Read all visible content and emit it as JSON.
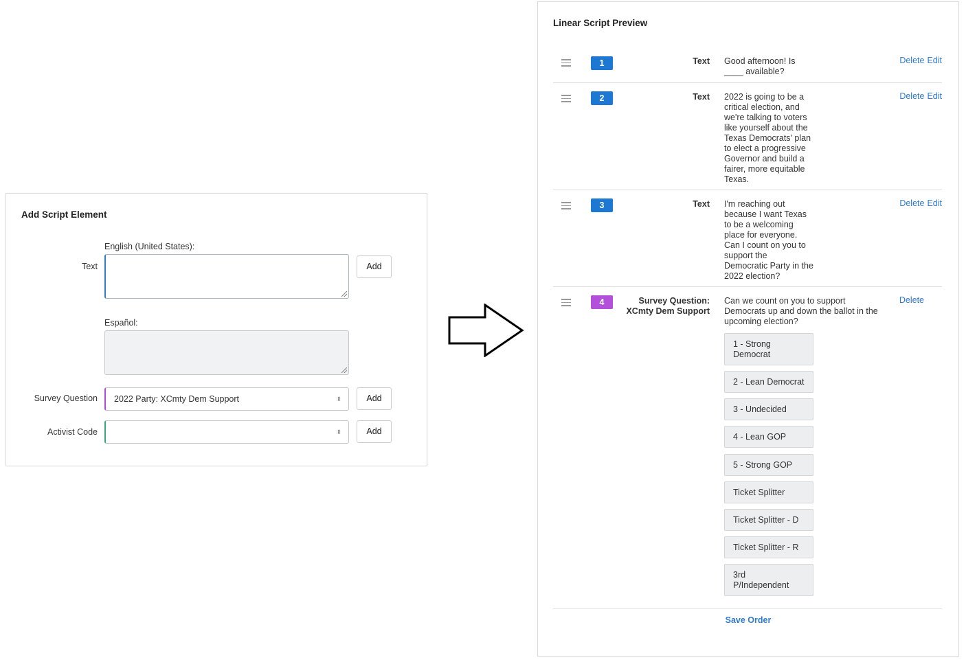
{
  "add_panel": {
    "title": "Add Script Element",
    "english_label": "English (United States):",
    "text_label": "Text",
    "spanish_label": "Español:",
    "survey_label": "Survey Question",
    "survey_value": "2022 Party: XCmty Dem Support",
    "activist_label": "Activist Code",
    "activist_value": "",
    "add_label": "Add"
  },
  "preview": {
    "title": "Linear Script Preview",
    "rows": [
      {
        "num": "1",
        "type": "Text",
        "text": [
          "Good afternoon! Is",
          "____ available?"
        ],
        "delete": "Delete",
        "edit": "Edit"
      },
      {
        "num": "2",
        "type": "Text",
        "text": [
          "2022 is going to be a",
          "critical election, and",
          "we're talking to voters",
          "like yourself about the",
          "Texas Democrats' plan",
          "to elect a progressive",
          "Governor and build a",
          "fairer, more equitable",
          "Texas."
        ],
        "delete": "Delete",
        "edit": "Edit"
      },
      {
        "num": "3",
        "type": "Text",
        "text": [
          "I'm reaching out",
          "because I want Texas",
          "to be a welcoming",
          "place for everyone.",
          "Can I count on you to",
          "support the",
          "Democratic Party in the",
          "2022 election?"
        ],
        "delete": "Delete",
        "edit": "Edit"
      },
      {
        "num": "4",
        "type": [
          "Survey Question:",
          "XCmty Dem Support"
        ],
        "text": [
          "Can we count on you to support",
          "Democrats up and down the ballot in the",
          "upcoming election?"
        ],
        "delete": "Delete"
      }
    ],
    "answers": [
      [
        "1 - Strong",
        "Democrat"
      ],
      [
        "2 - Lean Democrat"
      ],
      [
        "3 - Undecided"
      ],
      [
        "4 - Lean GOP"
      ],
      [
        "5 - Strong GOP"
      ],
      [
        "Ticket Splitter"
      ],
      [
        "Ticket Splitter - D"
      ],
      [
        "Ticket Splitter - R"
      ],
      [
        "3rd",
        "P/Independent"
      ]
    ],
    "save_order": "Save Order"
  },
  "colors": {
    "badge_blue": "#1c78d3",
    "badge_purple": "#b44fdb",
    "link_blue": "#2e7bd0"
  }
}
